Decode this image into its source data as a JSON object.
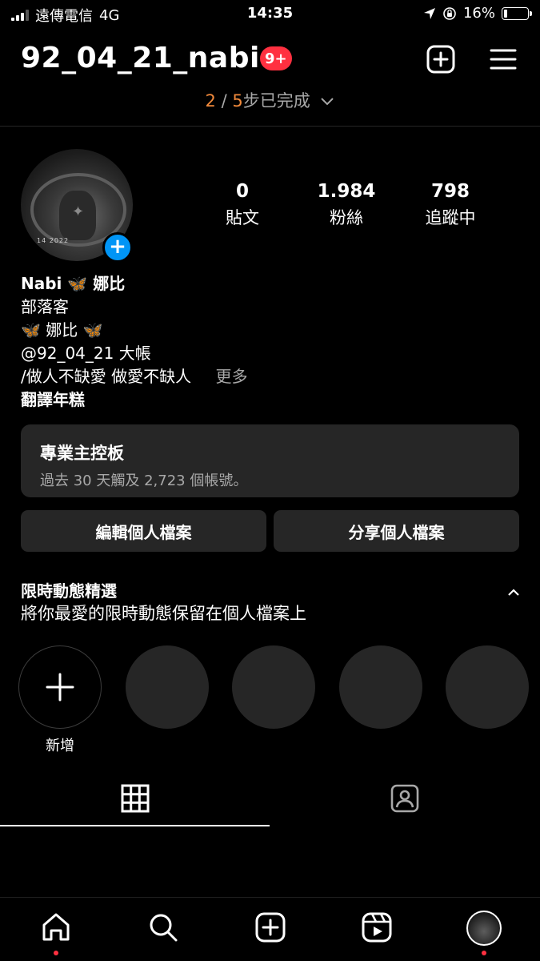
{
  "status_bar": {
    "carrier": "遠傳電信",
    "network": "4G",
    "time": "14:35",
    "battery": "16%",
    "battery_level": 0.16
  },
  "header": {
    "username": "92_04_21_nabi",
    "notification_badge": "9+",
    "setup_progress": {
      "done": "2",
      "separator": "/",
      "total": "5",
      "label": "步已完成"
    }
  },
  "profile": {
    "avatar_stamp": "14 2022",
    "stats": [
      {
        "value": "0",
        "label": "貼文"
      },
      {
        "value": "1.984",
        "label": "粉絲"
      },
      {
        "value": "798",
        "label": "追蹤中"
      }
    ],
    "name": "Nabi",
    "name_suffix": "娜比",
    "category": "部落客",
    "bio_line1": "娜比",
    "bio_line2": "@92_04_21 大帳",
    "bio_line3": "/做人不缺愛 做愛不缺人",
    "more": "更多",
    "translate": "翻譯年糕"
  },
  "dashboard": {
    "title": "專業主控板",
    "subtitle": "過去 30 天觸及 2,723 個帳號。"
  },
  "buttons": {
    "edit_profile": "編輯個人檔案",
    "share_profile": "分享個人檔案"
  },
  "highlights": {
    "title": "限時動態精選",
    "subtitle": "將你最愛的限時動態保留在個人檔案上",
    "new_label": "新增"
  },
  "colors": {
    "background": "#000000",
    "surface": "#262626",
    "accent_blue": "#0095f6",
    "badge_red": "#ff3040",
    "progress_orange": "#f28a3b",
    "muted_text": "#a8a8a8"
  },
  "icons": {
    "header": [
      "plus-square-icon",
      "menu-icon"
    ],
    "tabs": [
      "grid-icon",
      "tagged-icon"
    ],
    "nav": [
      "home-icon",
      "search-icon",
      "create-icon",
      "reels-icon",
      "profile-avatar"
    ]
  }
}
